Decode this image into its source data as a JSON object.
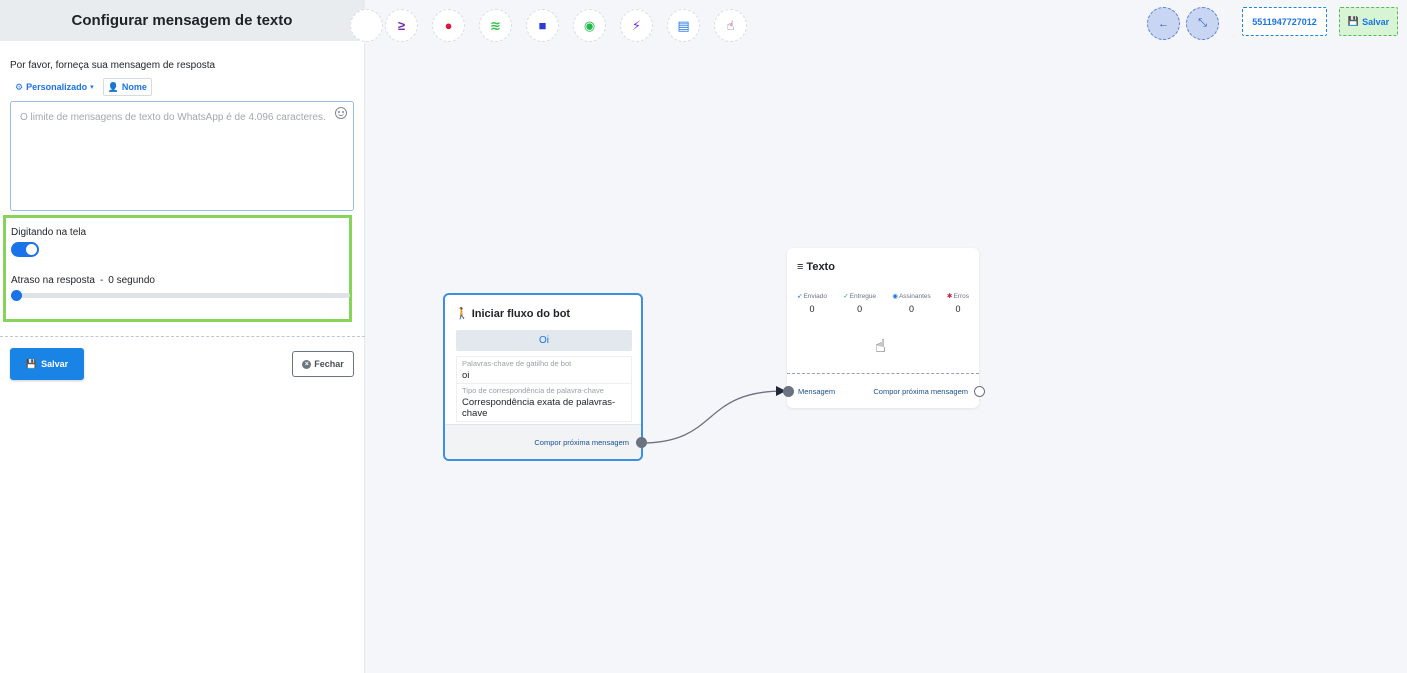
{
  "panel": {
    "title": "Configurar mensagem de texto",
    "prompt": "Por favor, forneça sua mensagem de resposta",
    "chips": {
      "personalizado": "Personalizado",
      "nome": "Nome"
    },
    "textarea_placeholder": "O limite de mensagens de texto do WhatsApp é de 4.096 caracteres.",
    "typing_label": "Digitando na tela",
    "typing_enabled": true,
    "delay_label": "Atraso na resposta",
    "delay_sep": "-",
    "delay_value": "0 segundo",
    "delay_fraction": 0,
    "save_label": "Salvar",
    "close_label": "Fechar"
  },
  "toolbar": {
    "icons": [
      "greater-equal-icon",
      "drop-icon",
      "stack-icon",
      "robot-icon",
      "palette-icon",
      "plug-icon",
      "excel-file-icon",
      "pointer-icon"
    ],
    "colors": [
      "#6f2da8",
      "#d6163a",
      "#2fbf4a",
      "#2f3bd0",
      "#1fba4a",
      "#7a2fe0",
      "#1a73e8",
      "#8c1d6a"
    ],
    "phone": "5511947727012",
    "save_label": "Salvar"
  },
  "start_node": {
    "title": "Iniciar fluxo do bot",
    "button": "Oi",
    "keyword_label": "Palavras-chave de gatilho de bot",
    "keyword_value": "oi",
    "match_label": "Tipo de correspondência de palavra-chave",
    "match_value": "Correspondência exata de palavras-chave",
    "footer": "Compor próxima mensagem"
  },
  "text_node": {
    "title": "Texto",
    "stats": [
      {
        "label": "Enviado",
        "value": "0",
        "color": "#1a73e8"
      },
      {
        "label": "Entregue",
        "value": "0",
        "color": "#1fa34a"
      },
      {
        "label": "Assinantes",
        "value": "0",
        "color": "#1a73e8"
      },
      {
        "label": "Erros",
        "value": "0",
        "color": "#d6163a"
      }
    ],
    "input_label": "Mensagem",
    "output_label": "Compor próxima mensagem"
  }
}
